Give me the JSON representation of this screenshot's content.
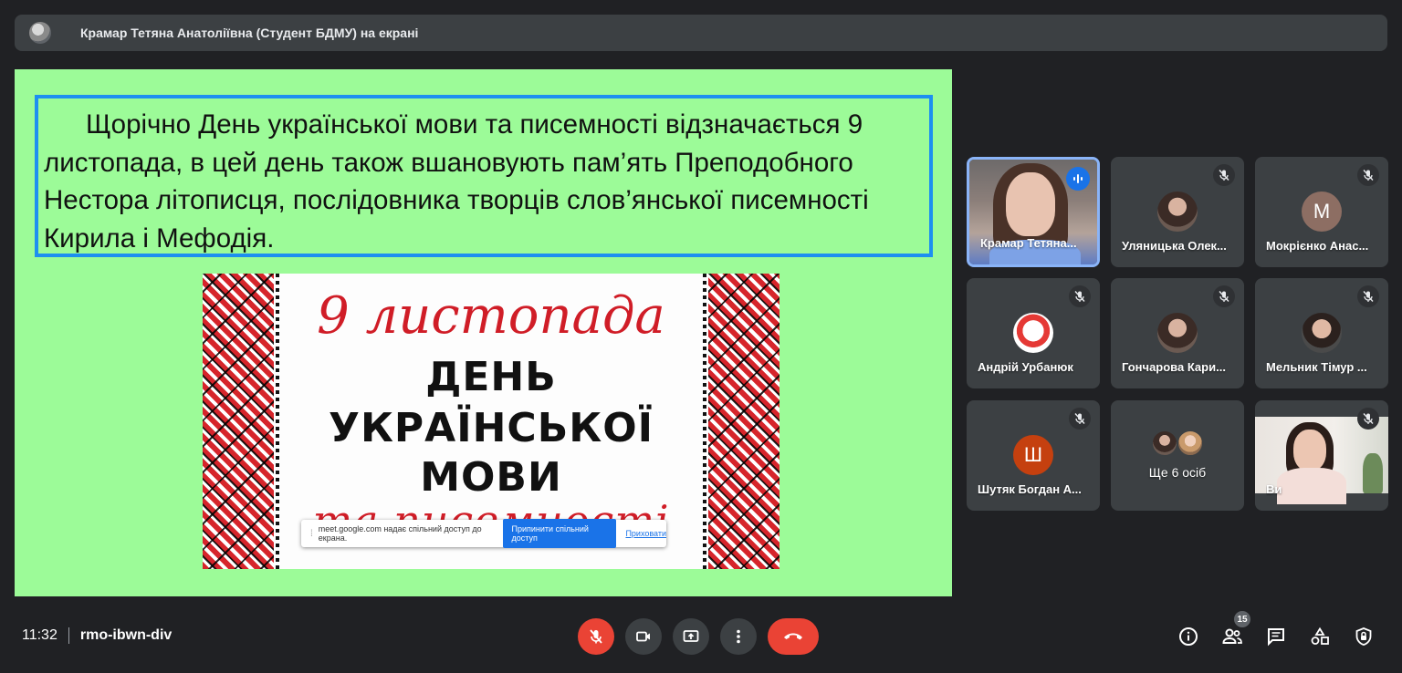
{
  "header": {
    "presenter_text": "Крамар Тетяна Анатоліївна (Студент БДМУ) на екрані"
  },
  "slide": {
    "paragraph": "Щорічно День української мови та писемності відзначається 9 листопада, в цей день також вшановують пам’ять Преподобного Нестора літописця, послідовника творців слов’янської писемності Кирила і Мефодія.",
    "poster": {
      "date": "9 листопада",
      "line1": "ДЕНЬ",
      "line2": "УКРАЇНСЬКОЇ",
      "line3": "МОВИ",
      "line4": "та писемності"
    },
    "share_notice": {
      "message": "meet.google.com надає спільний доступ до екрана.",
      "stop_label": "Припинити спільний доступ",
      "hide_label": "Приховати"
    }
  },
  "participants": [
    {
      "name": "Крамар Тетяна...",
      "speaking": true
    },
    {
      "name": "Уляницька Олек...",
      "muted": true
    },
    {
      "name": "Мокрієнко Анас...",
      "initial": "М",
      "muted": true
    },
    {
      "name": "Андрій Урбанюк",
      "muted": true
    },
    {
      "name": "Гончарова Кари...",
      "muted": true
    },
    {
      "name": "Мельник Тімур ...",
      "muted": true
    },
    {
      "name": "Шутяк Богдан А...",
      "initial": "Ш",
      "muted": true
    },
    {
      "name": "Ще 6 осіб"
    },
    {
      "name": "Ви",
      "muted": true
    }
  ],
  "footer": {
    "time": "11:32",
    "meeting_code": "rmo-ibwn-div",
    "participant_count": "15"
  },
  "colors": {
    "background": "#202124",
    "tile": "#3c4043",
    "slide_bg": "#9cfb98",
    "hangup": "#ea4335",
    "accent": "#1a73e8",
    "avatar_m": "#8d6e63",
    "avatar_sh": "#c5400f"
  }
}
